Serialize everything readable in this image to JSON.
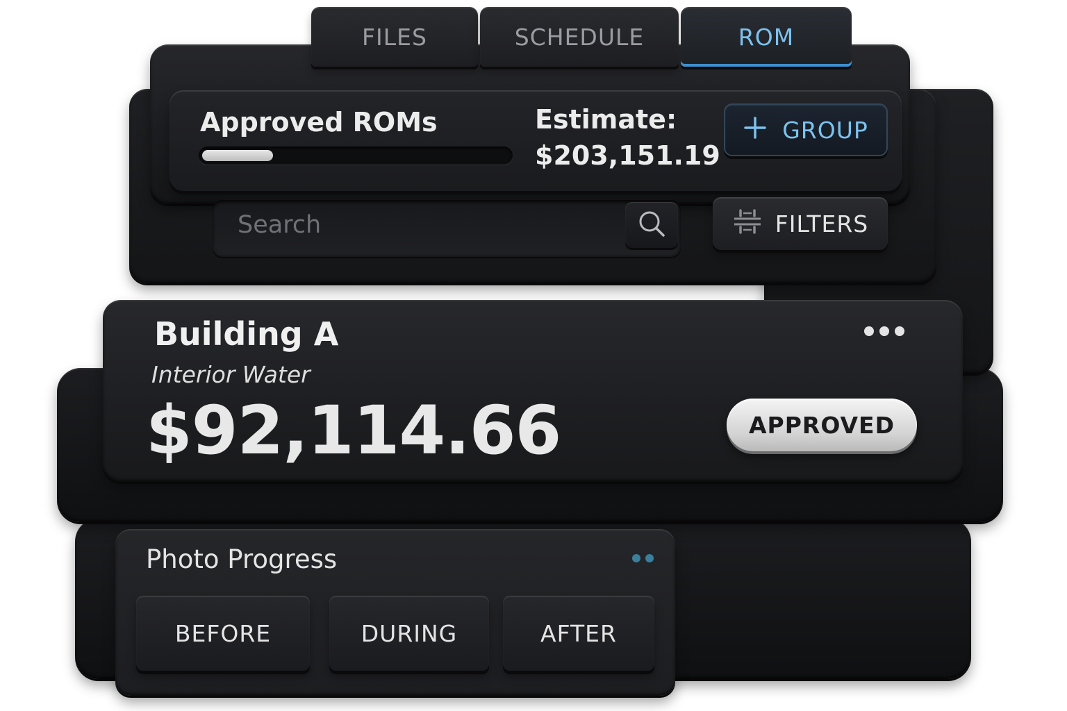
{
  "tabs": [
    {
      "label": "FILES",
      "active": false
    },
    {
      "label": "SCHEDULE",
      "active": false
    },
    {
      "label": "ROM",
      "active": true
    }
  ],
  "rom_summary": {
    "title": "Approved ROMs",
    "progress_fraction": 0.23,
    "estimate_label": "Estimate:",
    "estimate_value": "$203,151.19",
    "group_button": {
      "icon": "plus-icon",
      "label": "GROUP"
    }
  },
  "search": {
    "placeholder": "Search",
    "icon": "search-icon"
  },
  "filters_button": {
    "icon": "filter-sliders-icon",
    "label": "FILTERS"
  },
  "building_card": {
    "title": "Building A",
    "subtitle": "Interior Water",
    "amount": "$92,114.66",
    "status": "APPROVED",
    "menu_icon": "more-horizontal-icon"
  },
  "photo_progress": {
    "title": "Photo Progress",
    "buttons": [
      {
        "label": "BEFORE"
      },
      {
        "label": "DURING"
      },
      {
        "label": "AFTER"
      }
    ]
  },
  "colors": {
    "accent": "#7cc2ee",
    "tab_underline": "#3e8fd0",
    "surface": "#1e1f22",
    "text": "#ececec",
    "badge": "#d9d9d9"
  }
}
